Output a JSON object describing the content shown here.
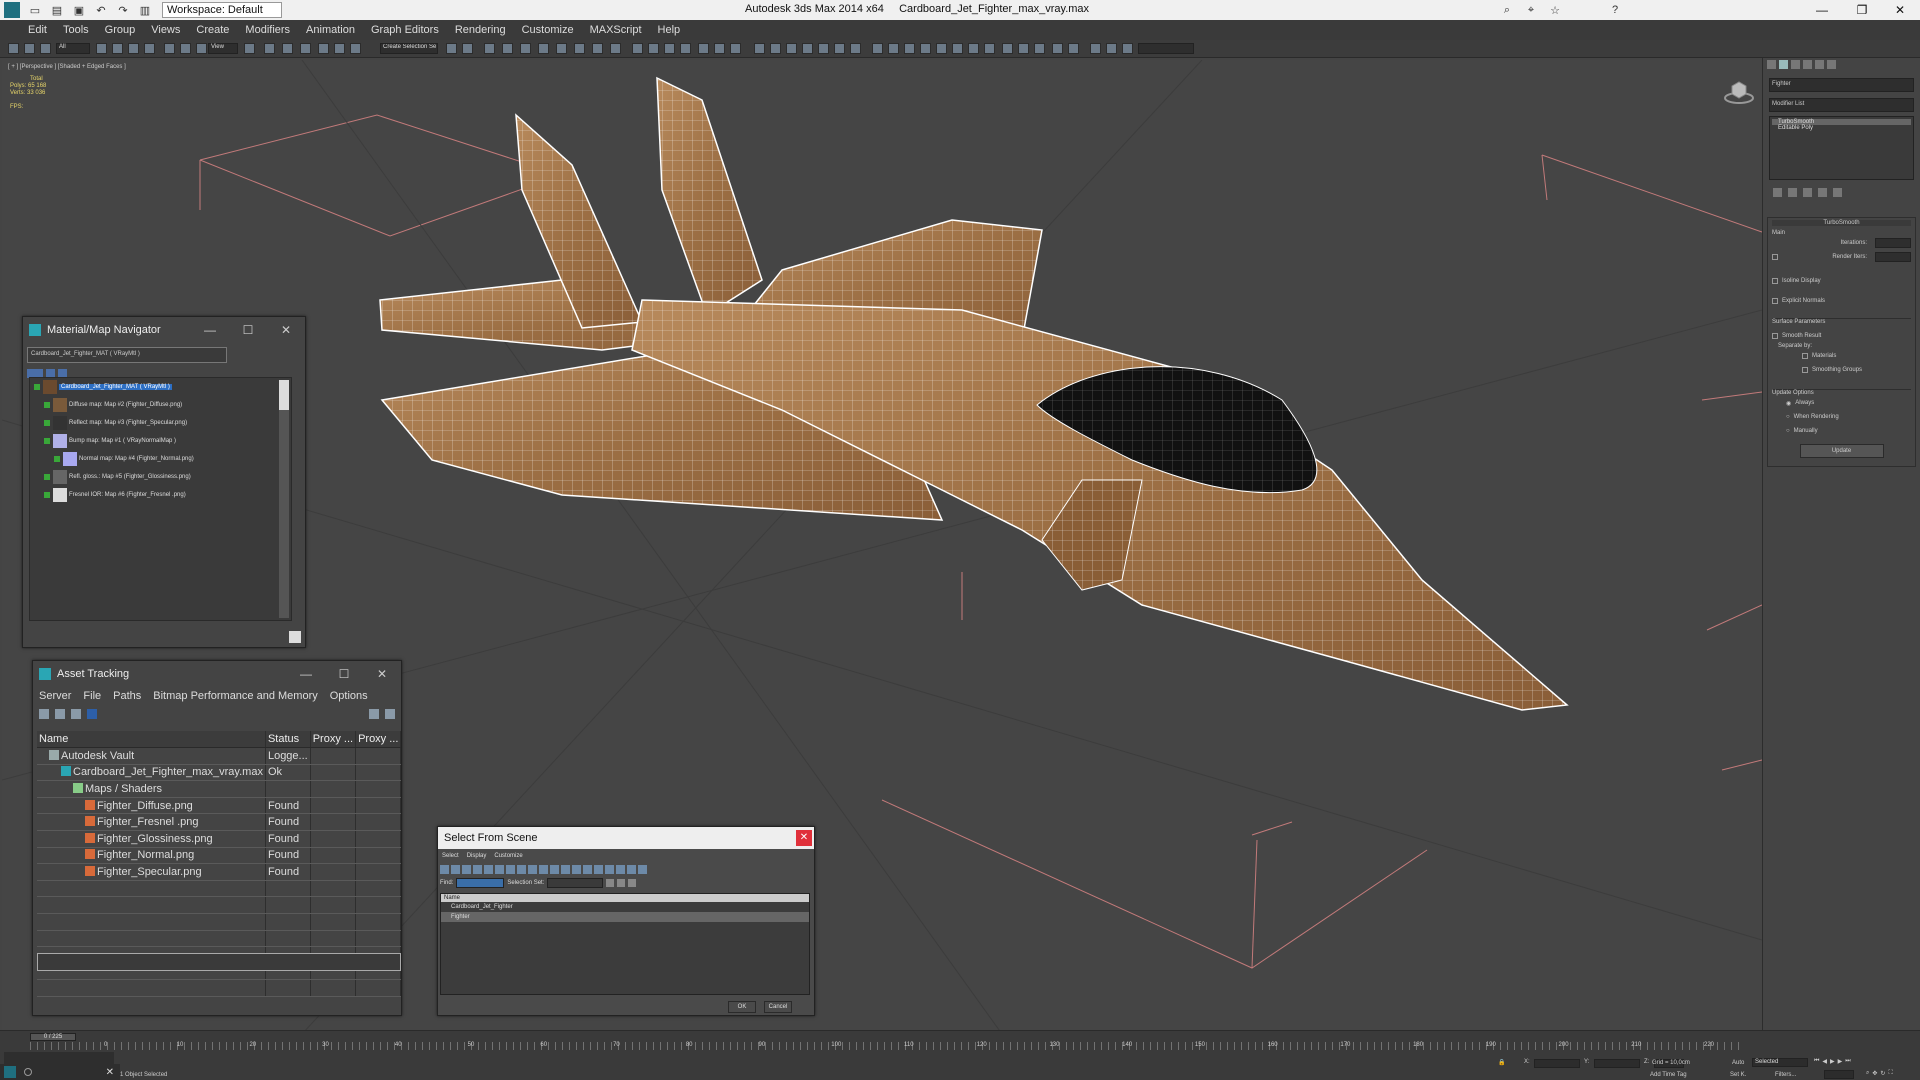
{
  "titlebar": {
    "app": "Autodesk 3ds Max  2014 x64",
    "file": "Cardboard_Jet_Fighter_max_vray.max",
    "workspace": "Workspace: Default"
  },
  "menu": [
    "Edit",
    "Tools",
    "Group",
    "Views",
    "Create",
    "Modifiers",
    "Animation",
    "Graph Editors",
    "Rendering",
    "Customize",
    "MAXScript",
    "Help"
  ],
  "toolbar": {
    "selection_filter": "All",
    "ref_coord": "View",
    "named_selection": "Create Selection Se"
  },
  "viewport": {
    "label": "[ + ] [Perspective ] [Shaded + Edged Faces ]",
    "stats": {
      "total_label": "Total",
      "polys_label": "Polys:",
      "polys_value": "65 168",
      "verts_label": "Verts:",
      "verts_value": "33 036",
      "fps_label": "FPS:"
    }
  },
  "command_panel": {
    "object_name": "Fighter",
    "modifier_list": "Modifier List",
    "stack": [
      "TurboSmooth",
      "Editable Poly"
    ],
    "rollout_title": "TurboSmooth",
    "main": "Main",
    "iterations": "Iterations:",
    "render_iters": "Render Iters:",
    "isoline": "Isoline Display",
    "explicit": "Explicit Normals",
    "surface": "Surface Parameters",
    "smooth_result": "Smooth Result",
    "separate_by": "Separate by:",
    "materials": "Materials",
    "smoothing_groups": "Smoothing Groups",
    "update_options": "Update Options",
    "always": "Always",
    "when_rendering": "When Rendering",
    "manually": "Manually",
    "update_btn": "Update"
  },
  "material_navigator": {
    "title": "Material/Map Navigator",
    "field": "Cardboard_Jet_Fighter_MAT  ( VRayMtl )",
    "items": [
      {
        "label": "Cardboard_Jet_Fighter_MAT  ( VRayMtl )",
        "thumb": "#6b4a2e"
      },
      {
        "label": "Diffuse map: Map #2 (Fighter_Diffuse.png)",
        "thumb": "#7a5a3a"
      },
      {
        "label": "Reflect map: Map #3 (Fighter_Specular.png)",
        "thumb": "#333333"
      },
      {
        "label": "Bump map: Map #1  ( VRayNormalMap )",
        "thumb": "#b0b0e8"
      },
      {
        "label": "Normal map: Map #4 (Fighter_Normal.png)",
        "thumb": "#a8a8f0"
      },
      {
        "label": "Refl. gloss.: Map #5 (Fighter_Glossiness.png)",
        "thumb": "#666666"
      },
      {
        "label": "Fresnel IOR: Map #6 (Fighter_Fresnel .png)",
        "thumb": "#dddddd"
      }
    ]
  },
  "asset_tracking": {
    "title": "Asset Tracking",
    "menu": [
      "Server",
      "File",
      "Paths",
      "Bitmap Performance and Memory",
      "Options"
    ],
    "columns": [
      "Name",
      "Status",
      "Proxy ...",
      "Proxy ..."
    ],
    "rows": [
      {
        "name": "Autodesk Vault",
        "status": "Logge...",
        "indent": 1
      },
      {
        "name": "Cardboard_Jet_Fighter_max_vray.max",
        "status": "Ok",
        "indent": 2
      },
      {
        "name": "Maps / Shaders",
        "status": "",
        "indent": 3
      },
      {
        "name": "Fighter_Diffuse.png",
        "status": "Found",
        "indent": 4
      },
      {
        "name": "Fighter_Fresnel .png",
        "status": "Found",
        "indent": 4
      },
      {
        "name": "Fighter_Glossiness.png",
        "status": "Found",
        "indent": 4
      },
      {
        "name": "Fighter_Normal.png",
        "status": "Found",
        "indent": 4
      },
      {
        "name": "Fighter_Specular.png",
        "status": "Found",
        "indent": 4
      }
    ]
  },
  "select_from_scene": {
    "title": "Select From Scene",
    "menu": [
      "Select",
      "Display",
      "Customize"
    ],
    "find_label": "Find:",
    "selection_set": "Selection Set:",
    "column": "Name",
    "rows": [
      "Cardboard_Jet_Fighter",
      "Fighter"
    ],
    "ok": "OK",
    "cancel": "Cancel"
  },
  "timeline": {
    "slider": "0 / 225",
    "ticks": [
      "0",
      "10",
      "20",
      "30",
      "40",
      "50",
      "60",
      "70",
      "80",
      "90",
      "100",
      "110",
      "120",
      "130",
      "140",
      "150",
      "160",
      "170",
      "180",
      "190",
      "200",
      "210",
      "220"
    ]
  },
  "statusbar": {
    "objects": "1 Object Selected",
    "grid": "Grid = 10,0cm",
    "auto": "Auto",
    "set_key": "Set K.",
    "selected": "Selected",
    "filters": "Filters...",
    "add_time_tag": "Add Time Tag",
    "x_label": "X:",
    "y_label": "Y:",
    "z_label": "Z:"
  },
  "colors": {
    "accent": "#2aa6b4",
    "grid_line": "#c27a7a",
    "wire": "#ffffff",
    "cardboard": "#a97c52"
  }
}
